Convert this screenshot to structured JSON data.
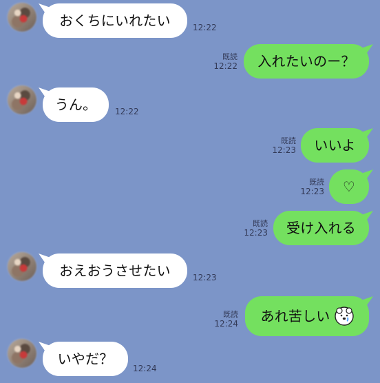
{
  "messages": [
    {
      "side": "left",
      "text": "おくちにいれたい",
      "time": "12:22"
    },
    {
      "side": "right",
      "text": "入れたいのー？",
      "read": "既読",
      "time": "12:22"
    },
    {
      "side": "left",
      "text": "うん。",
      "time": "12:22"
    },
    {
      "side": "right",
      "text": "いいよ",
      "read": "既読",
      "time": "12:23"
    },
    {
      "side": "right",
      "icon": "heart-outline-icon",
      "read": "既読",
      "time": "12:23"
    },
    {
      "side": "right",
      "text": "受け入れる",
      "read": "既読",
      "time": "12:23"
    },
    {
      "side": "left",
      "text": "おえおうさせたい",
      "time": "12:23"
    },
    {
      "side": "right",
      "text": "あれ苦しい",
      "icon": "white-bear-emoji-icon",
      "read": "既読",
      "time": "12:24"
    },
    {
      "side": "left",
      "text": "いやだ？",
      "time": "12:24"
    }
  ],
  "colors": {
    "background": "#7c95c8",
    "incoming_bubble": "#ffffff",
    "outgoing_bubble": "#74e05f",
    "meta_text": "#333a57"
  }
}
